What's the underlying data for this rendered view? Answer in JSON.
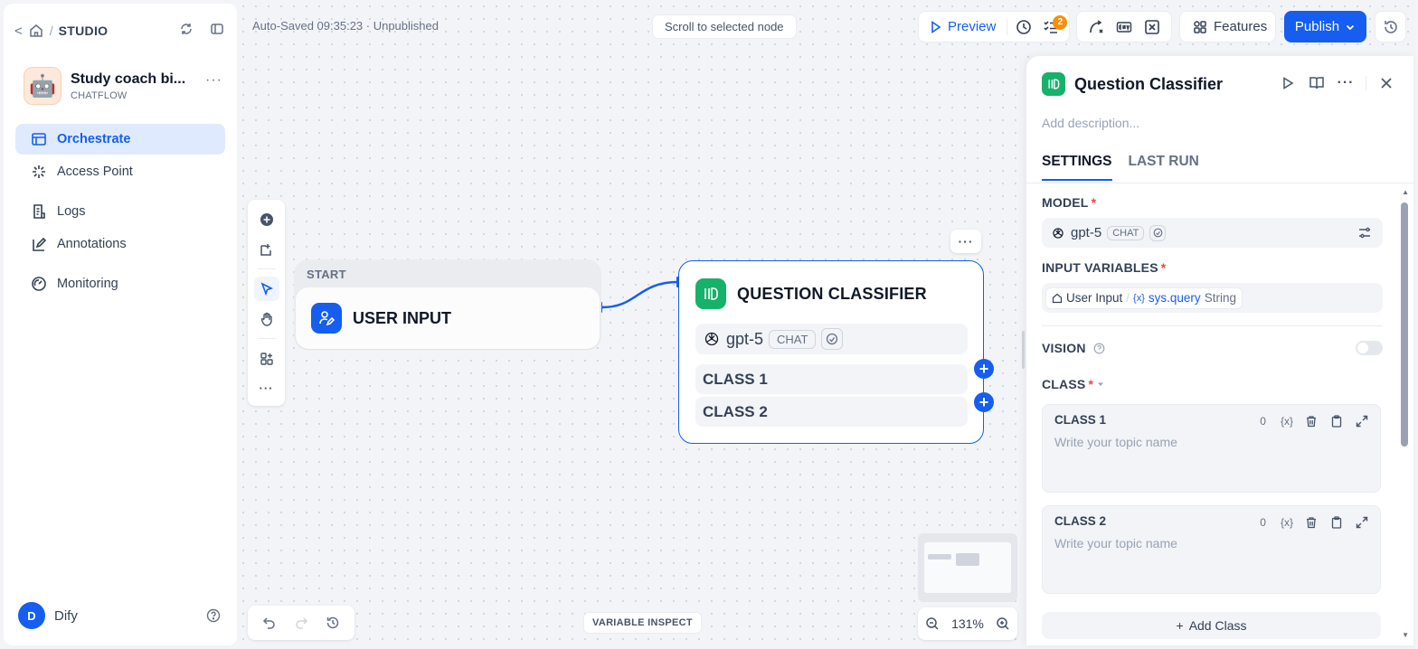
{
  "sidebar": {
    "breadcrumb": {
      "back": "<",
      "separator": "/",
      "studio": "STUDIO"
    },
    "app": {
      "emoji": "🤖",
      "name": "Study coach bi...",
      "type": "CHATFLOW",
      "more": "···"
    },
    "nav": [
      {
        "label": "Orchestrate",
        "icon": "orchestrate-icon"
      },
      {
        "label": "Access Point",
        "icon": "access-point-icon"
      },
      {
        "label": "Logs",
        "icon": "logs-icon"
      },
      {
        "label": "Annotations",
        "icon": "annotations-icon"
      },
      {
        "label": "Monitoring",
        "icon": "monitoring-icon"
      }
    ],
    "user": {
      "initial": "D",
      "name": "Dify"
    }
  },
  "topbar": {
    "autosave": "Auto-Saved 09:35:23 · Unpublished",
    "scroll_to_node": "Scroll to selected node",
    "preview": "Preview",
    "checklist_count": "2",
    "features": "Features",
    "publish": "Publish"
  },
  "canvas": {
    "start_node": {
      "label": "START",
      "title": "USER INPUT"
    },
    "classifier_node": {
      "title": "QUESTION CLASSIFIER",
      "model": "gpt-5",
      "model_mode": "CHAT",
      "classes": [
        "CLASS 1",
        "CLASS 2"
      ]
    },
    "node_more": "···",
    "variable_inspect": "VARIABLE INSPECT",
    "zoom": "131%"
  },
  "panel": {
    "title": "Question Classifier",
    "description_placeholder": "Add description...",
    "tabs": [
      "SETTINGS",
      "LAST RUN"
    ],
    "model_label": "MODEL",
    "model": {
      "name": "gpt-5",
      "mode": "CHAT"
    },
    "input_variables_label": "INPUT VARIABLES",
    "input_variable": {
      "node": "User Input",
      "separator": "/",
      "prefix": "{x}",
      "name": "sys.query",
      "type": "String"
    },
    "vision_label": "VISION",
    "class_label": "CLASS",
    "required_mark": "*",
    "classes": [
      {
        "title": "CLASS 1",
        "count": "0",
        "placeholder": "Write your topic name"
      },
      {
        "title": "CLASS 2",
        "count": "0",
        "placeholder": "Write your topic name"
      }
    ],
    "add_class": "Add Class",
    "var_button": "{x}"
  }
}
